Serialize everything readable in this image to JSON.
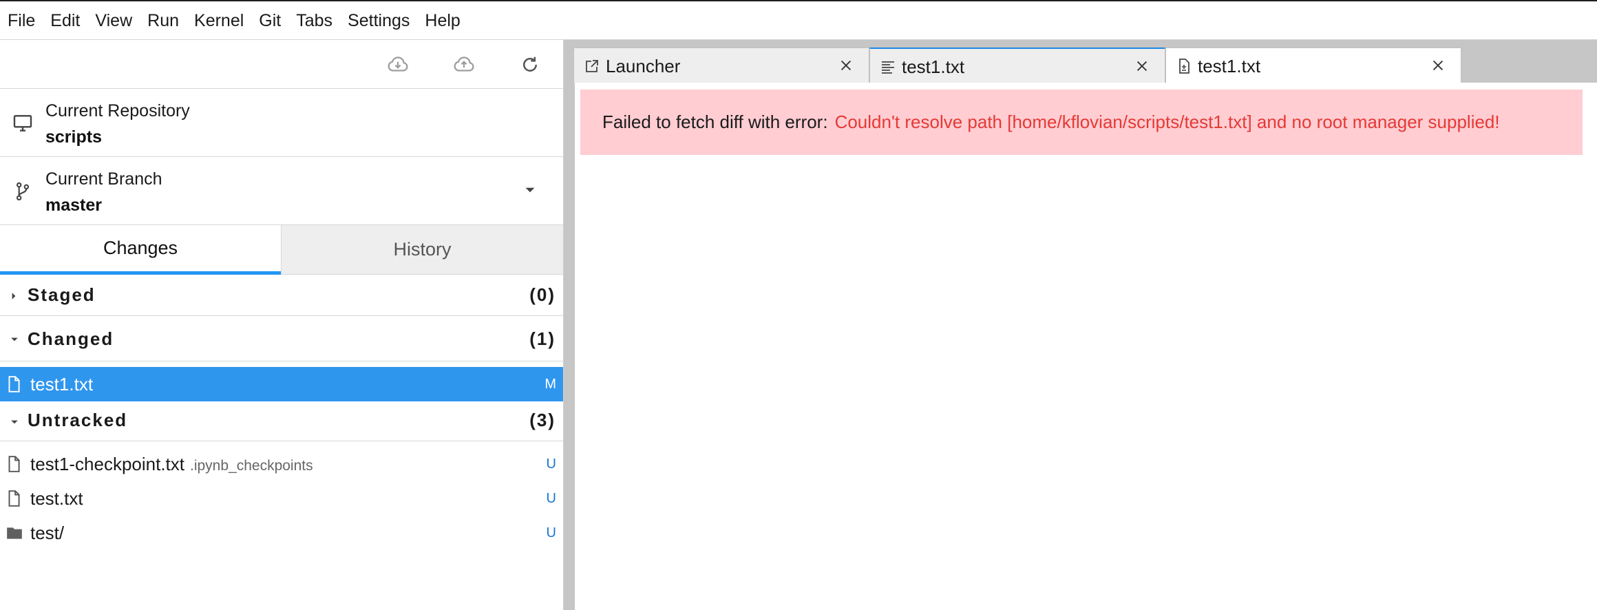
{
  "menu": [
    "File",
    "Edit",
    "View",
    "Run",
    "Kernel",
    "Git",
    "Tabs",
    "Settings",
    "Help"
  ],
  "toolbar": {
    "icons": [
      "cloud-download-icon",
      "cloud-upload-icon",
      "refresh-icon"
    ]
  },
  "repo": {
    "label": "Current Repository",
    "name": "scripts"
  },
  "branch": {
    "label": "Current Branch",
    "name": "master"
  },
  "side_tabs": {
    "changes": "Changes",
    "history": "History"
  },
  "sections": {
    "staged": {
      "label": "Staged",
      "count": "(0)"
    },
    "changed": {
      "label": "Changed",
      "count": "(1)"
    },
    "untracked": {
      "label": "Untracked",
      "count": "(3)"
    }
  },
  "changed_files": [
    {
      "name": "test1.txt",
      "path": "",
      "status": "M"
    }
  ],
  "untracked_files": [
    {
      "name": "test1-checkpoint.txt",
      "path": ".ipynb_checkpoints",
      "status": "U"
    },
    {
      "name": "test.txt",
      "path": "",
      "status": "U"
    },
    {
      "name": "test/",
      "path": "",
      "status": "U"
    }
  ],
  "doc_tabs": [
    {
      "label": "Launcher",
      "icon": "launcher-icon"
    },
    {
      "label": "test1.txt",
      "icon": "text-file-icon"
    },
    {
      "label": "test1.txt",
      "icon": "diff-file-icon"
    }
  ],
  "error": {
    "prefix": "Failed to fetch diff with error:",
    "message": "Couldn't resolve path [home/kflovian/scripts/test1.txt] and no root manager supplied!"
  },
  "colors": {
    "accent": "#2196f3",
    "selected_row": "#2f96ee",
    "error_bg": "#ffcdd2",
    "error_text": "#e53935",
    "status_text": "#1976d2"
  }
}
